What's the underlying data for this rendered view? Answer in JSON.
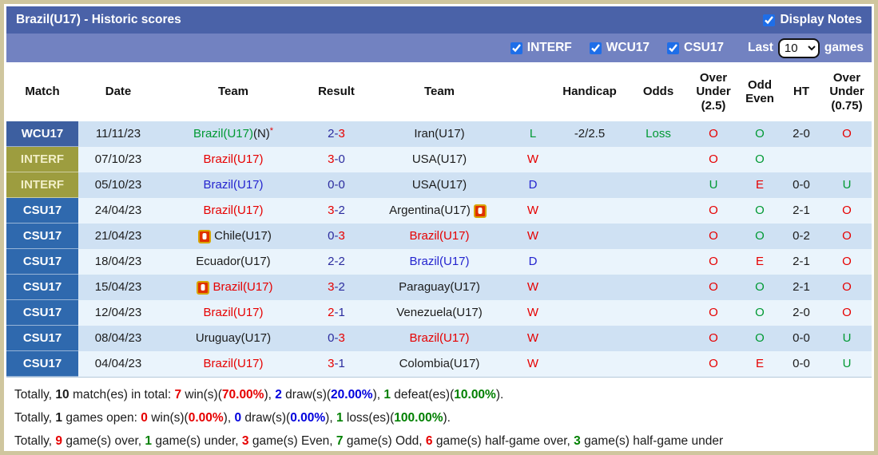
{
  "theme": {
    "titlebar": "#4a62a8",
    "filterbar": "#7282c1",
    "row_odd": "#cfe1f3",
    "row_even": "#eaf4fc",
    "frame": "#cfc69e",
    "checkbox_accent": "#1e6ee8"
  },
  "colors": {
    "red": "#e60000",
    "green": "#009933",
    "navy": "#2b2b9e",
    "blue": "#2424cf",
    "black": "#1c1c1c",
    "blue2": "#0000dd",
    "green2": "#008000"
  },
  "badges": {
    "WCU17": {
      "bg": "#3d5fa0",
      "fg": "#ffffff"
    },
    "INTERF": {
      "bg": "#9d9d3f",
      "fg": "#f2efc8"
    },
    "CSU17": {
      "bg": "#2f69ae",
      "fg": "#ffffff"
    }
  },
  "header": {
    "title": "Brazil(U17) - Historic scores",
    "display_notes_label": "Display Notes",
    "display_notes_checked": true
  },
  "filter_bar": {
    "competitions": [
      {
        "label": "INTERF",
        "checked": true
      },
      {
        "label": "WCU17",
        "checked": true
      },
      {
        "label": "CSU17",
        "checked": true
      }
    ],
    "last_label": "Last",
    "last_value": "10",
    "games_label": "games"
  },
  "table": {
    "dash": "-",
    "columns": [
      "Match",
      "Date",
      "Team",
      "Result",
      "Team",
      "",
      "Handicap",
      "Odds",
      "Over Under (2.5)",
      "Odd Even",
      "HT",
      "Over Under (0.75)"
    ],
    "rows": [
      {
        "competition": "WCU17",
        "date": "11/11/23",
        "team1": {
          "name": "Brazil(U17)",
          "color": "green",
          "suffix": "(N)",
          "star": "*",
          "card_before": false,
          "card_after": false
        },
        "result": {
          "s1": "2",
          "c1": "navy",
          "s2": "3",
          "c2": "red"
        },
        "team2": {
          "name": "Iran(U17)",
          "color": "black",
          "card_before": false,
          "card_after": false
        },
        "wdl": {
          "t": "L",
          "c": "green"
        },
        "handicap": "-2/2.5",
        "odds": {
          "t": "Loss",
          "c": "green"
        },
        "ou25": {
          "t": "O",
          "c": "red"
        },
        "oddeven": {
          "t": "O",
          "c": "green"
        },
        "ht": "2-0",
        "ou075": {
          "t": "O",
          "c": "red"
        }
      },
      {
        "competition": "INTERF",
        "date": "07/10/23",
        "team1": {
          "name": "Brazil(U17)",
          "color": "red",
          "suffix": "",
          "star": "",
          "card_before": false,
          "card_after": false
        },
        "result": {
          "s1": "3",
          "c1": "red",
          "s2": "0",
          "c2": "navy"
        },
        "team2": {
          "name": "USA(U17)",
          "color": "black",
          "card_before": false,
          "card_after": false
        },
        "wdl": {
          "t": "W",
          "c": "red"
        },
        "handicap": "",
        "odds": {
          "t": "",
          "c": "black"
        },
        "ou25": {
          "t": "O",
          "c": "red"
        },
        "oddeven": {
          "t": "O",
          "c": "green"
        },
        "ht": "",
        "ou075": {
          "t": "",
          "c": "black"
        }
      },
      {
        "competition": "INTERF",
        "date": "05/10/23",
        "team1": {
          "name": "Brazil(U17)",
          "color": "blue",
          "suffix": "",
          "star": "",
          "card_before": false,
          "card_after": false
        },
        "result": {
          "s1": "0",
          "c1": "navy",
          "s2": "0",
          "c2": "navy"
        },
        "team2": {
          "name": "USA(U17)",
          "color": "black",
          "card_before": false,
          "card_after": false
        },
        "wdl": {
          "t": "D",
          "c": "blue"
        },
        "handicap": "",
        "odds": {
          "t": "",
          "c": "black"
        },
        "ou25": {
          "t": "U",
          "c": "green"
        },
        "oddeven": {
          "t": "E",
          "c": "red"
        },
        "ht": "0-0",
        "ou075": {
          "t": "U",
          "c": "green"
        }
      },
      {
        "competition": "CSU17",
        "date": "24/04/23",
        "team1": {
          "name": "Brazil(U17)",
          "color": "red",
          "suffix": "",
          "star": "",
          "card_before": false,
          "card_after": false
        },
        "result": {
          "s1": "3",
          "c1": "red",
          "s2": "2",
          "c2": "navy"
        },
        "team2": {
          "name": "Argentina(U17)",
          "color": "black",
          "card_before": false,
          "card_after": true
        },
        "wdl": {
          "t": "W",
          "c": "red"
        },
        "handicap": "",
        "odds": {
          "t": "",
          "c": "black"
        },
        "ou25": {
          "t": "O",
          "c": "red"
        },
        "oddeven": {
          "t": "O",
          "c": "green"
        },
        "ht": "2-1",
        "ou075": {
          "t": "O",
          "c": "red"
        }
      },
      {
        "competition": "CSU17",
        "date": "21/04/23",
        "team1": {
          "name": "Chile(U17)",
          "color": "black",
          "suffix": "",
          "star": "",
          "card_before": true,
          "card_after": false
        },
        "result": {
          "s1": "0",
          "c1": "navy",
          "s2": "3",
          "c2": "red"
        },
        "team2": {
          "name": "Brazil(U17)",
          "color": "red",
          "card_before": false,
          "card_after": false
        },
        "wdl": {
          "t": "W",
          "c": "red"
        },
        "handicap": "",
        "odds": {
          "t": "",
          "c": "black"
        },
        "ou25": {
          "t": "O",
          "c": "red"
        },
        "oddeven": {
          "t": "O",
          "c": "green"
        },
        "ht": "0-2",
        "ou075": {
          "t": "O",
          "c": "red"
        }
      },
      {
        "competition": "CSU17",
        "date": "18/04/23",
        "team1": {
          "name": "Ecuador(U17)",
          "color": "black",
          "suffix": "",
          "star": "",
          "card_before": false,
          "card_after": false
        },
        "result": {
          "s1": "2",
          "c1": "navy",
          "s2": "2",
          "c2": "navy"
        },
        "team2": {
          "name": "Brazil(U17)",
          "color": "blue",
          "card_before": false,
          "card_after": false
        },
        "wdl": {
          "t": "D",
          "c": "blue"
        },
        "handicap": "",
        "odds": {
          "t": "",
          "c": "black"
        },
        "ou25": {
          "t": "O",
          "c": "red"
        },
        "oddeven": {
          "t": "E",
          "c": "red"
        },
        "ht": "2-1",
        "ou075": {
          "t": "O",
          "c": "red"
        }
      },
      {
        "competition": "CSU17",
        "date": "15/04/23",
        "team1": {
          "name": "Brazil(U17)",
          "color": "red",
          "suffix": "",
          "star": "",
          "card_before": true,
          "card_after": false
        },
        "result": {
          "s1": "3",
          "c1": "red",
          "s2": "2",
          "c2": "navy"
        },
        "team2": {
          "name": "Paraguay(U17)",
          "color": "black",
          "card_before": false,
          "card_after": false
        },
        "wdl": {
          "t": "W",
          "c": "red"
        },
        "handicap": "",
        "odds": {
          "t": "",
          "c": "black"
        },
        "ou25": {
          "t": "O",
          "c": "red"
        },
        "oddeven": {
          "t": "O",
          "c": "green"
        },
        "ht": "2-1",
        "ou075": {
          "t": "O",
          "c": "red"
        }
      },
      {
        "competition": "CSU17",
        "date": "12/04/23",
        "team1": {
          "name": "Brazil(U17)",
          "color": "red",
          "suffix": "",
          "star": "",
          "card_before": false,
          "card_after": false
        },
        "result": {
          "s1": "2",
          "c1": "red",
          "s2": "1",
          "c2": "navy"
        },
        "team2": {
          "name": "Venezuela(U17)",
          "color": "black",
          "card_before": false,
          "card_after": false
        },
        "wdl": {
          "t": "W",
          "c": "red"
        },
        "handicap": "",
        "odds": {
          "t": "",
          "c": "black"
        },
        "ou25": {
          "t": "O",
          "c": "red"
        },
        "oddeven": {
          "t": "O",
          "c": "green"
        },
        "ht": "2-0",
        "ou075": {
          "t": "O",
          "c": "red"
        }
      },
      {
        "competition": "CSU17",
        "date": "08/04/23",
        "team1": {
          "name": "Uruguay(U17)",
          "color": "black",
          "suffix": "",
          "star": "",
          "card_before": false,
          "card_after": false
        },
        "result": {
          "s1": "0",
          "c1": "navy",
          "s2": "3",
          "c2": "red"
        },
        "team2": {
          "name": "Brazil(U17)",
          "color": "red",
          "card_before": false,
          "card_after": false
        },
        "wdl": {
          "t": "W",
          "c": "red"
        },
        "handicap": "",
        "odds": {
          "t": "",
          "c": "black"
        },
        "ou25": {
          "t": "O",
          "c": "red"
        },
        "oddeven": {
          "t": "O",
          "c": "green"
        },
        "ht": "0-0",
        "ou075": {
          "t": "U",
          "c": "green"
        }
      },
      {
        "competition": "CSU17",
        "date": "04/04/23",
        "team1": {
          "name": "Brazil(U17)",
          "color": "red",
          "suffix": "",
          "star": "",
          "card_before": false,
          "card_after": false
        },
        "result": {
          "s1": "3",
          "c1": "red",
          "s2": "1",
          "c2": "navy"
        },
        "team2": {
          "name": "Colombia(U17)",
          "color": "black",
          "card_before": false,
          "card_after": false
        },
        "wdl": {
          "t": "W",
          "c": "red"
        },
        "handicap": "",
        "odds": {
          "t": "",
          "c": "black"
        },
        "ou25": {
          "t": "O",
          "c": "red"
        },
        "oddeven": {
          "t": "E",
          "c": "red"
        },
        "ht": "0-0",
        "ou075": {
          "t": "U",
          "c": "green"
        }
      }
    ]
  },
  "summary": {
    "lines": [
      [
        {
          "t": "Totally, "
        },
        {
          "t": "10",
          "b": true
        },
        {
          "t": " match(es) in total: "
        },
        {
          "t": "7",
          "b": true,
          "c": "red"
        },
        {
          "t": " win(s)("
        },
        {
          "t": "70.00%",
          "b": true,
          "c": "red"
        },
        {
          "t": "), "
        },
        {
          "t": "2",
          "b": true,
          "c": "blue2"
        },
        {
          "t": " draw(s)("
        },
        {
          "t": "20.00%",
          "b": true,
          "c": "blue2"
        },
        {
          "t": "), "
        },
        {
          "t": "1",
          "b": true,
          "c": "green2"
        },
        {
          "t": " defeat(es)("
        },
        {
          "t": "10.00%",
          "b": true,
          "c": "green2"
        },
        {
          "t": ")."
        }
      ],
      [
        {
          "t": "Totally, "
        },
        {
          "t": "1",
          "b": true
        },
        {
          "t": " games open: "
        },
        {
          "t": "0",
          "b": true,
          "c": "red"
        },
        {
          "t": " win(s)("
        },
        {
          "t": "0.00%",
          "b": true,
          "c": "red"
        },
        {
          "t": "), "
        },
        {
          "t": "0",
          "b": true,
          "c": "blue2"
        },
        {
          "t": " draw(s)("
        },
        {
          "t": "0.00%",
          "b": true,
          "c": "blue2"
        },
        {
          "t": "), "
        },
        {
          "t": "1",
          "b": true,
          "c": "green2"
        },
        {
          "t": " loss(es)("
        },
        {
          "t": "100.00%",
          "b": true,
          "c": "green2"
        },
        {
          "t": ")."
        }
      ],
      [
        {
          "t": "Totally, "
        },
        {
          "t": "9",
          "b": true,
          "c": "red"
        },
        {
          "t": " game(s) over, "
        },
        {
          "t": "1",
          "b": true,
          "c": "green2"
        },
        {
          "t": " game(s) under, "
        },
        {
          "t": "3",
          "b": true,
          "c": "red"
        },
        {
          "t": " game(s) Even, "
        },
        {
          "t": "7",
          "b": true,
          "c": "green2"
        },
        {
          "t": " game(s) Odd, "
        },
        {
          "t": "6",
          "b": true,
          "c": "red"
        },
        {
          "t": " game(s) half-game over, "
        },
        {
          "t": "3",
          "b": true,
          "c": "green2"
        },
        {
          "t": " game(s) half-game under"
        }
      ]
    ]
  }
}
